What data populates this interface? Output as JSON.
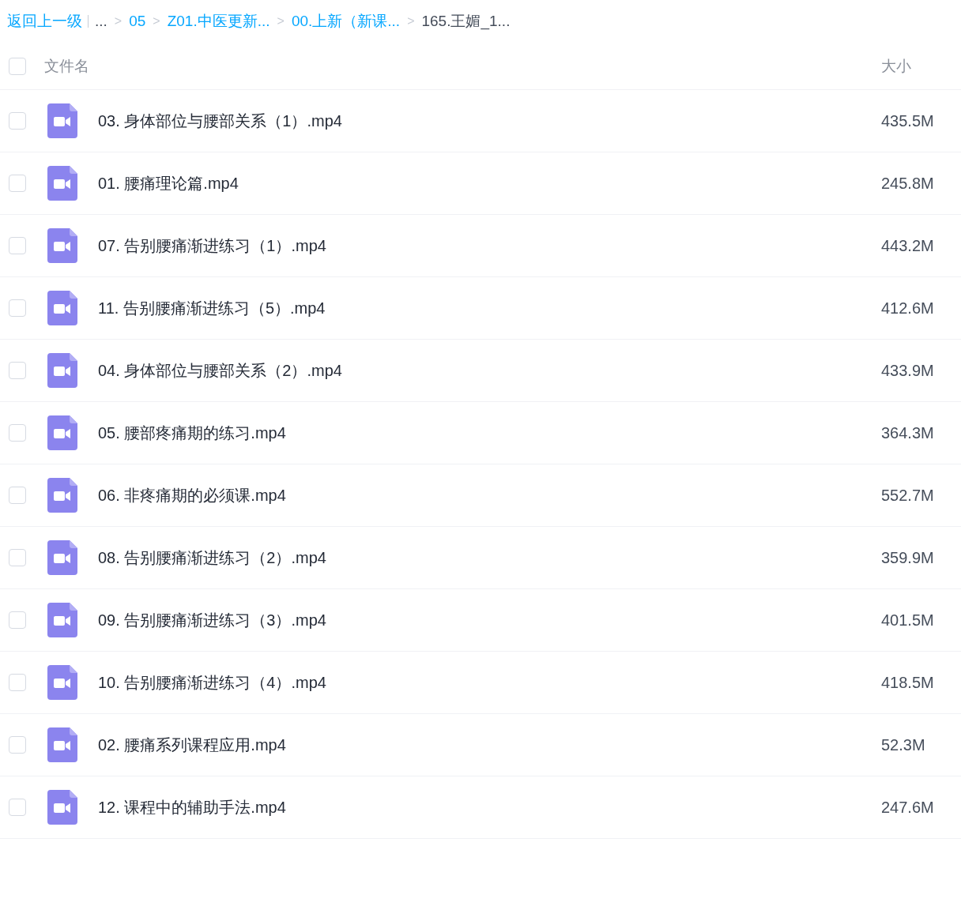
{
  "breadcrumb": {
    "back": "返回上一级",
    "separator": ">",
    "items": [
      {
        "label": "...",
        "kind": "text"
      },
      {
        "label": "05",
        "kind": "link"
      },
      {
        "label": "Z01.中医更新...",
        "kind": "link"
      },
      {
        "label": "00.上新（新课...",
        "kind": "link"
      },
      {
        "label": "165.王媚_1...",
        "kind": "text"
      }
    ]
  },
  "table": {
    "select_all": {
      "checked": false
    },
    "columns": [
      "文件名",
      "大小"
    ],
    "rows": [
      {
        "name": "03. 身体部位与腰部关系（1）.mp4",
        "size": "435.5M",
        "checked": false
      },
      {
        "name": "01. 腰痛理论篇.mp4",
        "size": "245.8M",
        "checked": false
      },
      {
        "name": "07. 告别腰痛渐进练习（1）.mp4",
        "size": "443.2M",
        "checked": false
      },
      {
        "name": "11. 告别腰痛渐进练习（5）.mp4",
        "size": "412.6M",
        "checked": false
      },
      {
        "name": "04. 身体部位与腰部关系（2）.mp4",
        "size": "433.9M",
        "checked": false
      },
      {
        "name": "05. 腰部疼痛期的练习.mp4",
        "size": "364.3M",
        "checked": false
      },
      {
        "name": "06. 非疼痛期的必须课.mp4",
        "size": "552.7M",
        "checked": false
      },
      {
        "name": "08. 告别腰痛渐进练习（2）.mp4",
        "size": "359.9M",
        "checked": false
      },
      {
        "name": "09. 告别腰痛渐进练习（3）.mp4",
        "size": "401.5M",
        "checked": false
      },
      {
        "name": "10. 告别腰痛渐进练习（4）.mp4",
        "size": "418.5M",
        "checked": false
      },
      {
        "name": "02. 腰痛系列课程应用.mp4",
        "size": "52.3M",
        "checked": false
      },
      {
        "name": "12. 课程中的辅助手法.mp4",
        "size": "247.6M",
        "checked": false
      }
    ]
  }
}
